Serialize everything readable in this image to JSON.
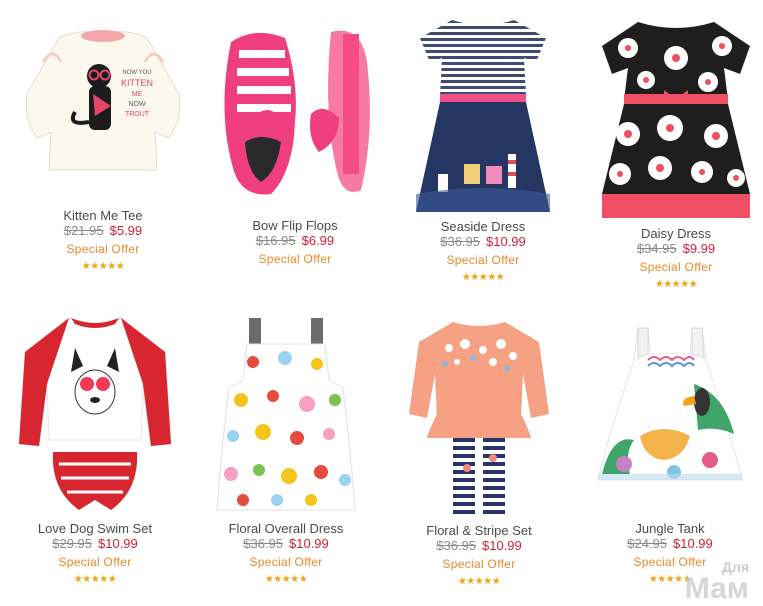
{
  "products": [
    {
      "name": "Kitten Me Tee",
      "old_price": "$21.95",
      "new_price": "$5.99",
      "offer": "Special Offer",
      "rating": 5,
      "tee_text": "Now you KITTEN me - NOW TROUT"
    },
    {
      "name": "Bow Flip Flops",
      "old_price": "$16.95",
      "new_price": "$6.99",
      "offer": "Special Offer",
      "rating": 5
    },
    {
      "name": "Seaside Dress",
      "old_price": "$36.95",
      "new_price": "$10.99",
      "offer": "Special Offer",
      "rating": 5
    },
    {
      "name": "Daisy Dress",
      "old_price": "$34.95",
      "new_price": "$9.99",
      "offer": "Special Offer",
      "rating": 5
    },
    {
      "name": "Love Dog Swim Set",
      "old_price": "$29.95",
      "new_price": "$10.99",
      "offer": "Special Offer",
      "rating": 5
    },
    {
      "name": "Floral Overall Dress",
      "old_price": "$36.95",
      "new_price": "$10.99",
      "offer": "Special Offer",
      "rating": 5
    },
    {
      "name": "Floral & Stripe Set",
      "old_price": "$36.95",
      "new_price": "$10.99",
      "offer": "Special Offer",
      "rating": 5
    },
    {
      "name": "Jungle Tank",
      "old_price": "$24.95",
      "new_price": "$10.99",
      "offer": "Special Offer",
      "rating": 5
    }
  ],
  "watermark": {
    "top": "Для",
    "main": "Мам"
  },
  "colors": {
    "price_new": "#d6203a",
    "price_old": "#8a8a8a",
    "offer": "#e9892b",
    "stars": "#f2a313",
    "name": "#4a4a4a"
  }
}
